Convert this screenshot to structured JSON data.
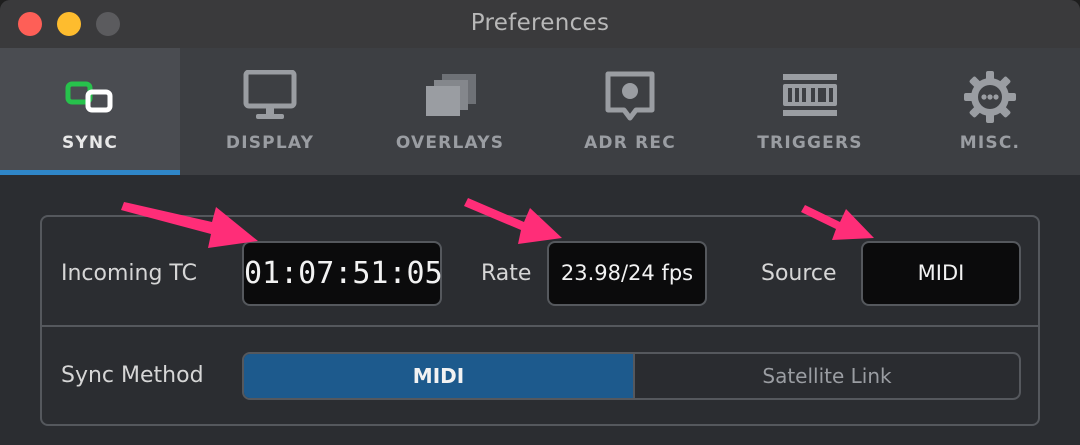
{
  "window": {
    "title": "Preferences"
  },
  "tabs": [
    {
      "id": "sync",
      "label": "SYNC",
      "icon": "sync-icon",
      "active": true
    },
    {
      "id": "display",
      "label": "DISPLAY",
      "icon": "monitor-icon",
      "active": false
    },
    {
      "id": "overlays",
      "label": "OVERLAYS",
      "icon": "overlays-icon",
      "active": false
    },
    {
      "id": "adr_rec",
      "label": "ADR REC",
      "icon": "adr-rec-icon",
      "active": false
    },
    {
      "id": "triggers",
      "label": "TRIGGERS",
      "icon": "midi-icon",
      "active": false
    },
    {
      "id": "misc",
      "label": "MISC.",
      "icon": "gear-icon",
      "active": false
    }
  ],
  "sync": {
    "incoming_tc_label": "Incoming TC",
    "incoming_tc_value": "01:07:51:05",
    "rate_label": "Rate",
    "rate_value": "23.98/24 fps",
    "source_label": "Source",
    "source_value": "MIDI",
    "sync_method_label": "Sync Method",
    "sync_method_options": [
      "MIDI",
      "Satellite Link"
    ],
    "sync_method_selected": "MIDI"
  },
  "colors": {
    "accent": "#2f86c8",
    "selected_segment": "#1d5a8d",
    "sync_icon_green": "#27c24c",
    "annotation_arrow": "#ff2d78"
  }
}
